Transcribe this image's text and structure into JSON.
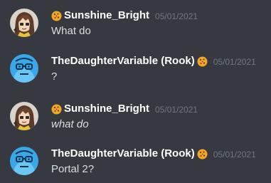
{
  "messages": [
    {
      "username": "Sunshine_Bright",
      "timestamp": "05/01/2021",
      "content": "What do",
      "italic": false,
      "avatar": "anime-character-avatar",
      "badge_position": "before"
    },
    {
      "username": "TheDaughterVariable (Rook)",
      "timestamp": "05/01/2021",
      "content": "?",
      "italic": false,
      "avatar": "glasses-face-avatar",
      "badge_position": "after"
    },
    {
      "username": "Sunshine_Bright",
      "timestamp": "05/01/2021",
      "content": "what do",
      "italic": true,
      "avatar": "anime-character-avatar",
      "badge_position": "before"
    },
    {
      "username": "TheDaughterVariable (Rook)",
      "timestamp": "05/01/2021",
      "content": "Portal 2?",
      "italic": false,
      "avatar": "glasses-face-avatar",
      "badge_position": "after"
    }
  ],
  "colors": {
    "background": "#36393f",
    "username": "#ffffff",
    "timestamp": "#72767d",
    "text": "#dcddde",
    "badge": "#f5a623"
  }
}
